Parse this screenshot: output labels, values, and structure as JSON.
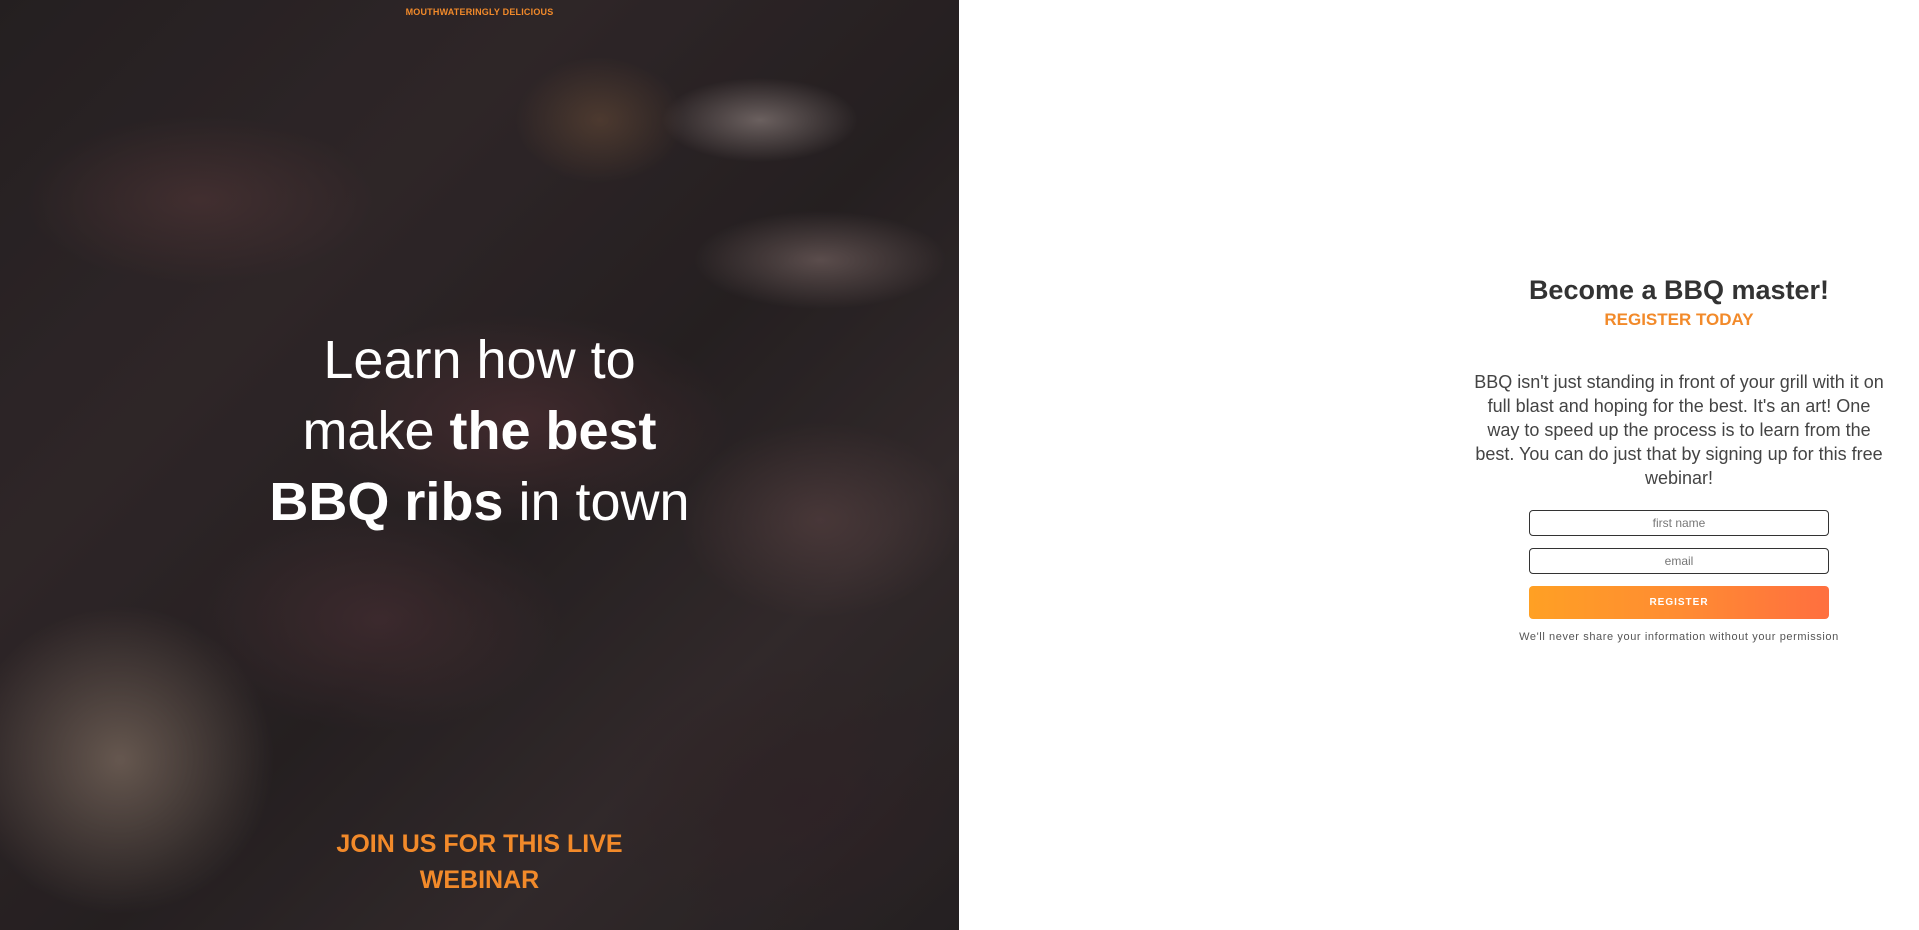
{
  "hero": {
    "kicker": "MOUTHWATERINGLY DELICIOUS",
    "headline": {
      "line1": "Learn how to",
      "line2_light": "make ",
      "line2_bold": "the best",
      "line3_bold": "BBQ ribs",
      "line3_light": " in town"
    },
    "cta": {
      "line1": "JOIN US FOR THIS LIVE",
      "line2": "WEBINAR"
    }
  },
  "panel": {
    "title": "Become a BBQ master!",
    "subtitle": "REGISTER TODAY",
    "body": "BBQ isn't just standing in front of your grill with it on full blast and hoping for the best. It's an art! One way to speed up the process is to learn from the best. You can do just that by signing up for this free webinar!",
    "form": {
      "first_name_placeholder": "first name",
      "first_name_value": "",
      "email_placeholder": "email",
      "email_value": "",
      "register_label": "REGISTER"
    },
    "privacy": "We'll never share your information without your permission"
  },
  "colors": {
    "accent": "#f28a2a",
    "button_gradient_start": "#ffa024",
    "button_gradient_end": "#ff6f3f",
    "heading": "#333333"
  }
}
